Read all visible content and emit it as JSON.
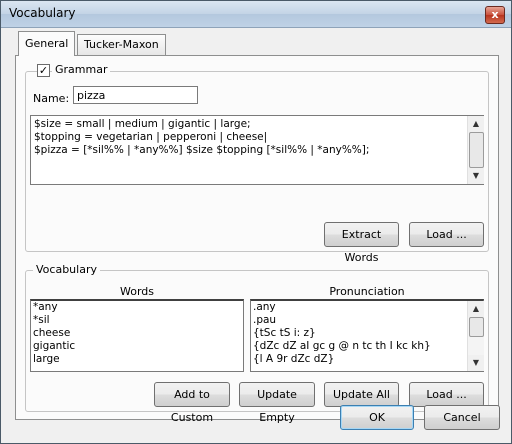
{
  "window": {
    "title": "Vocabulary",
    "close_glyph": "x"
  },
  "tabs": [
    {
      "label": "General"
    },
    {
      "label": "Tucker-Maxon"
    }
  ],
  "grammar": {
    "group_label": "Grammar",
    "enabled": true,
    "check_glyph": "✓",
    "name_label": "Name:",
    "name_value": "pizza",
    "text": "$size = small | medium | gigantic | large;\n$topping = vegetarian | pepperoni | cheese|\n$pizza = [*sil%% | *any%%] $size $topping [*sil%% | *any%%];",
    "extract_button": "Extract Words",
    "load_button": "Load ..."
  },
  "vocabulary": {
    "group_label": "Vocabulary",
    "words_header": "Words",
    "pron_header": "Pronunciation",
    "words": [
      "*any",
      "*sil",
      "cheese",
      "gigantic",
      "large"
    ],
    "pronunciations": [
      ".any",
      ".pau",
      "{tSc tS i: z}",
      "{dZc dZ aI gc g @ n tc th I kc kh}",
      "{l A 9r dZc dZ}"
    ],
    "add_custom_button": "Add to Custom",
    "update_empty_button": "Update Empty",
    "update_all_button": "Update All",
    "load_button": "Load ..."
  },
  "dialog": {
    "ok_button": "OK",
    "cancel_button": "Cancel"
  },
  "colors": {
    "accent": "#3c7fb1",
    "close": "#c9503c"
  },
  "icons": {
    "up": "scroll-up-icon",
    "down": "scroll-down-icon"
  }
}
